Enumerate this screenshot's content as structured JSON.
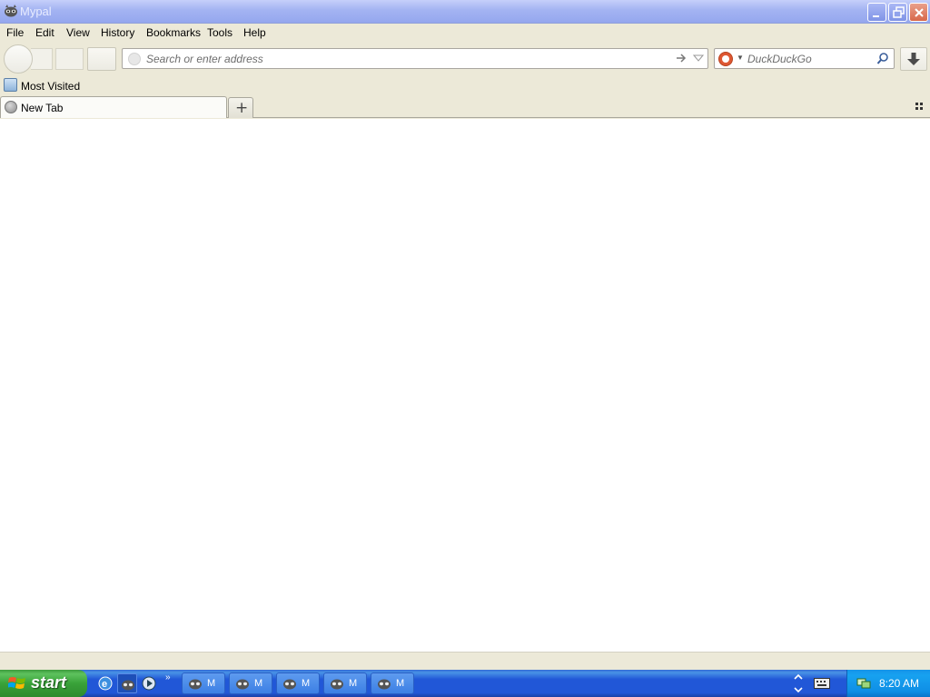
{
  "window": {
    "title": "Mypal",
    "app_icon": "raccoon-icon",
    "controls": [
      "minimize-icon",
      "restore-icon",
      "close-icon"
    ]
  },
  "menu": {
    "items": [
      "File",
      "Edit",
      "View",
      "History",
      "Bookmarks",
      "Tools",
      "Help"
    ]
  },
  "navbar": {
    "url_placeholder": "Search or enter address",
    "search_placeholder": "DuckDuckGo",
    "search_engine_icon": "duckduckgo-icon"
  },
  "bookmarks": {
    "items": [
      {
        "label": "Most Visited",
        "icon": "most-visited-icon"
      }
    ]
  },
  "tabs": {
    "items": [
      {
        "label": "New Tab",
        "icon": "globe-icon"
      }
    ],
    "new_tab_symbol": "+"
  },
  "taskbar": {
    "start_label": "start",
    "quick_launch": [
      "ie-icon",
      "raccoon-icon",
      "media-player-icon"
    ],
    "quick_launch_more": "»",
    "task_buttons": [
      {
        "label": "M",
        "icon": "raccoon-icon"
      },
      {
        "label": "M",
        "icon": "raccoon-icon"
      },
      {
        "label": "M",
        "icon": "raccoon-icon"
      },
      {
        "label": "M",
        "icon": "raccoon-icon"
      },
      {
        "label": "M",
        "icon": "raccoon-icon"
      }
    ],
    "clock": "8:20 AM"
  },
  "colors": {
    "title_bar": "#a3b3f2",
    "chrome": "#ece9d8",
    "taskbar": "#2157d7",
    "start_button": "#39a239",
    "tray": "#0f8ee5"
  }
}
